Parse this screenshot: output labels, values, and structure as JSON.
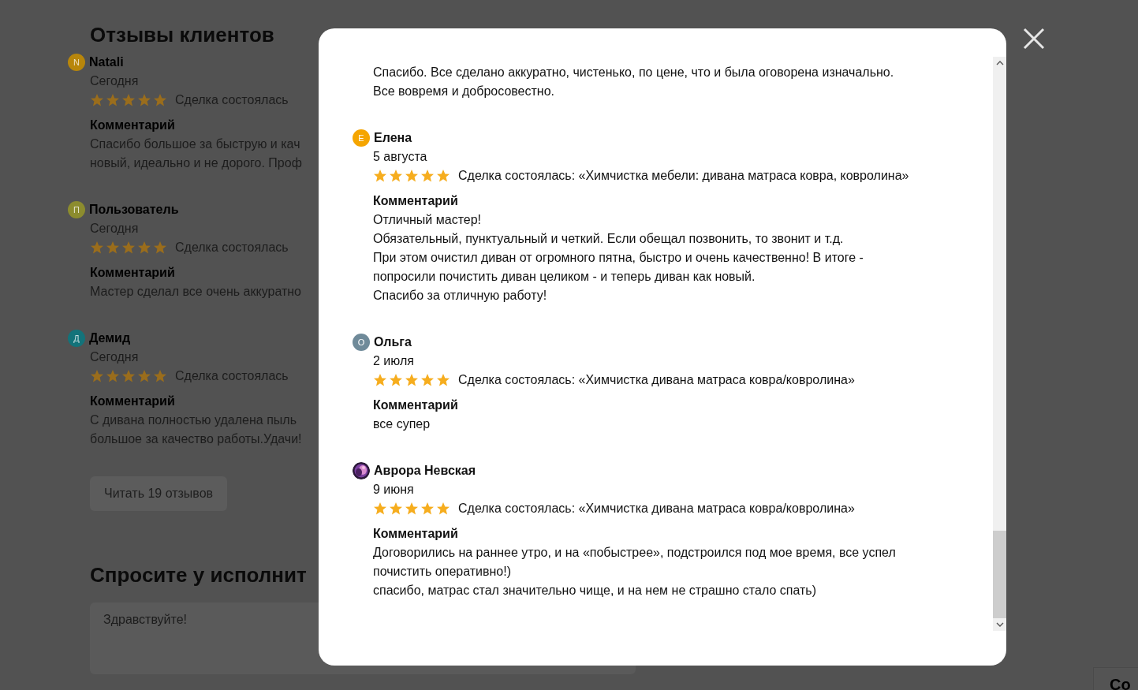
{
  "page": {
    "heading": "Отзывы клиентов",
    "reviews": [
      {
        "initial": "N",
        "color": "#b8860b",
        "name": "Natali",
        "date": "Сегодня",
        "stars": 5,
        "deal": "Сделка состоялась",
        "comment_label": "Комментарий",
        "comment_lines": [
          "Спасибо большое за быструю и кач",
          "новый, идеально и не дорого. Проф"
        ]
      },
      {
        "initial": "П",
        "color": "#8c8c2e",
        "name": "Пользователь",
        "date": "Сегодня",
        "stars": 5,
        "deal": "Сделка состоялась",
        "comment_label": "Комментарий",
        "comment_lines": [
          "Мастер сделал все очень аккуратно"
        ]
      },
      {
        "initial": "Д",
        "color": "#13737a",
        "name": "Демид",
        "date": "Сегодня",
        "stars": 5,
        "deal": "Сделка состоялась",
        "comment_label": "Комментарий",
        "comment_lines": [
          "С дивана полностью удалена пыль",
          "большое за качество работы.Удачи!"
        ]
      }
    ],
    "read_more_button": "Читать 19 отзывов",
    "ask_heading": "Спросите у исполнит",
    "message_field": {
      "value": "Здравствуйте!"
    },
    "corner_card": "Со"
  },
  "modal": {
    "top_comment_lines": [
      "Спасибо. Все сделано аккуратно, чистенько, по цене, что и была оговорена изначально.",
      "Все вовремя и добросовестно."
    ],
    "reviews": [
      {
        "kind": "letter",
        "initial": "Е",
        "color": "#f5a500",
        "name": "Елена",
        "date": "5 августа",
        "stars": 5,
        "deal": "Сделка состоялась: «Химчистка мебели: дивана матраса ковра, ковролина»",
        "comment_label": "Комментарий",
        "comment_lines": [
          "Отличный мастер!",
          "Обязательный, пунктуальный и четкий. Если обещал позвонить, то звонит и т.д.",
          "При этом очистил диван от огромного пятна, быстро и очень качественно! В итоге -",
          "попросили почистить диван целиком - и теперь диван как новый.",
          "Спасибо за отличную работу!"
        ]
      },
      {
        "kind": "letter",
        "initial": "О",
        "color": "#6f8a99",
        "name": "Ольга",
        "date": "2 июля",
        "stars": 5,
        "deal": "Сделка состоялась: «Химчистка дивана матраса ковра/ковролина»",
        "comment_label": "Комментарий",
        "comment_lines": [
          "все супер"
        ]
      },
      {
        "kind": "picture",
        "name": "Аврора Невская",
        "date": "9 июня",
        "stars": 5,
        "deal": "Сделка состоялась: «Химчистка дивана матраса ковра/ковролина»",
        "comment_label": "Комментарий",
        "comment_lines": [
          "Договорились на раннее утро, и на «побыстрее», подстроился под мое время, все успел",
          "почистить оперативно!)",
          "спасибо, матрас стал значительно чище, и на нем не страшно стало спать)"
        ]
      }
    ]
  }
}
